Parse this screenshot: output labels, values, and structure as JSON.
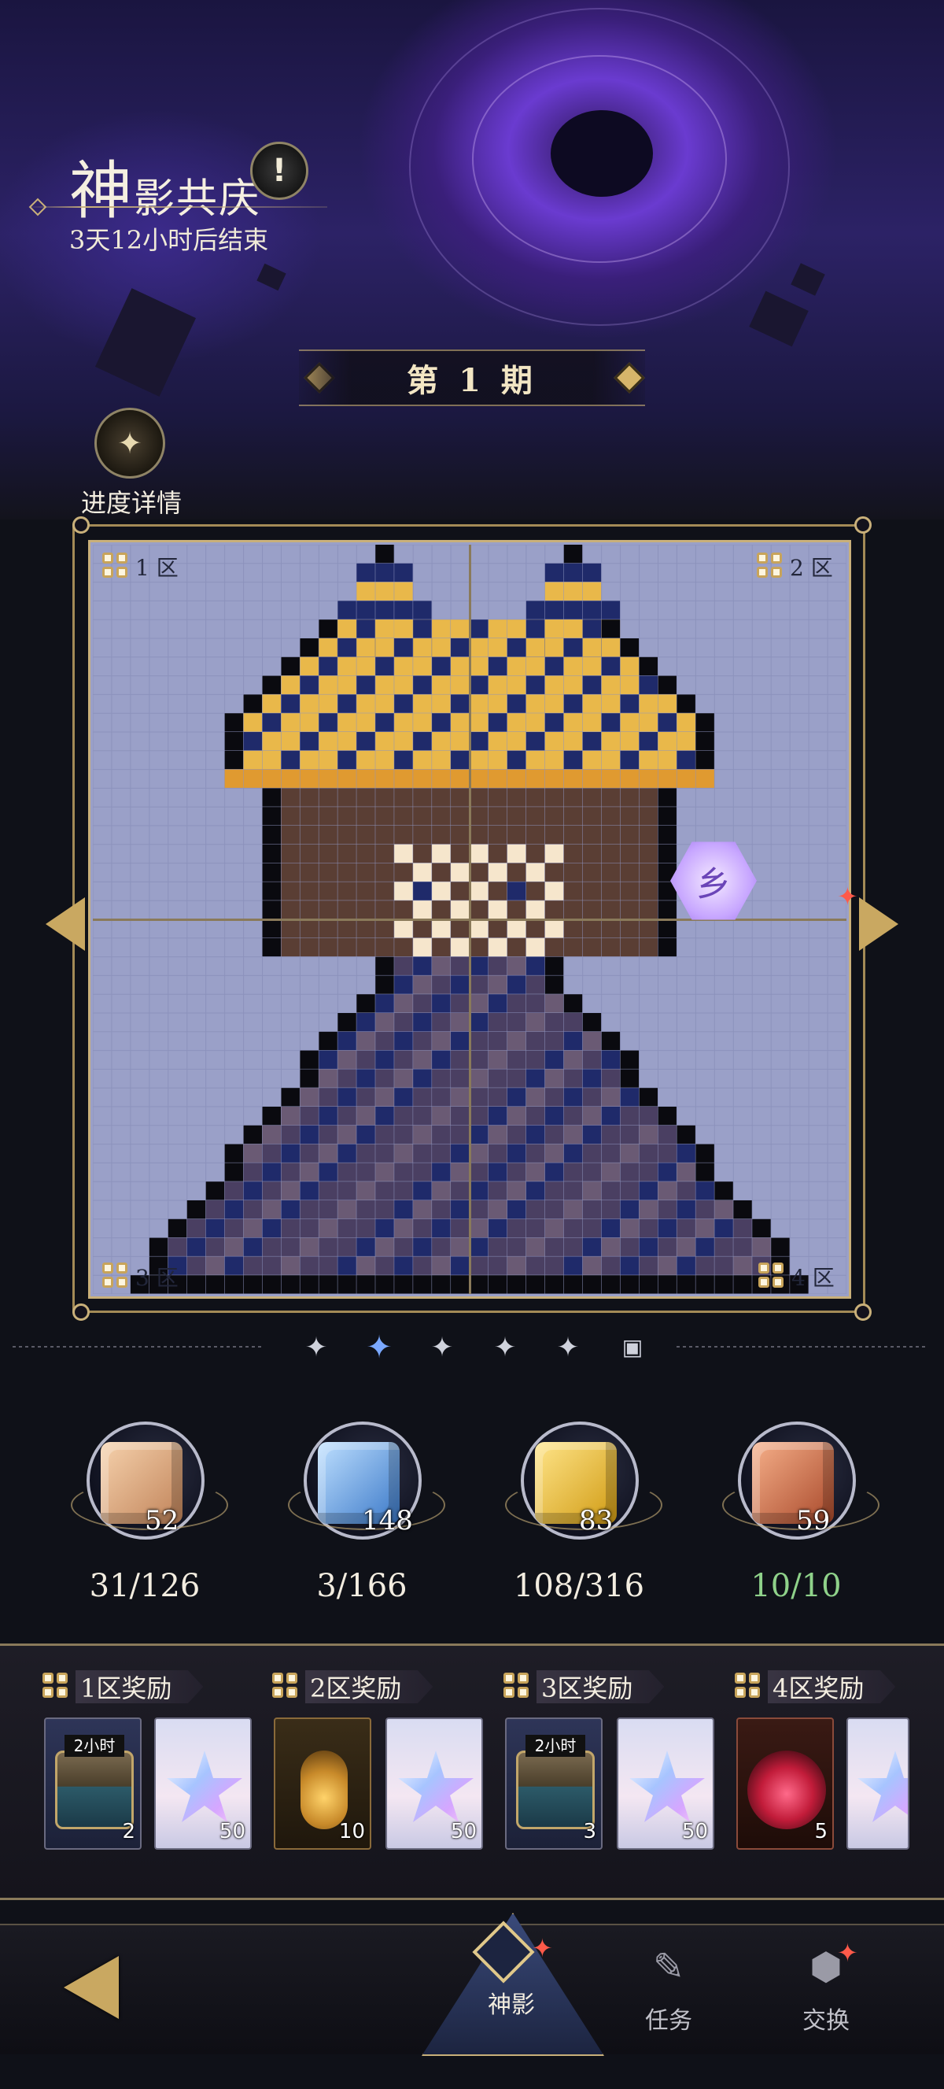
{
  "header": {
    "title_first_char": "神",
    "title_rest": "影共庆",
    "timer": "3天12小时后结束",
    "info_icon": "!",
    "period": "第 1 期",
    "progress_detail_label": "进度详情"
  },
  "board": {
    "zones": [
      {
        "label": "1 区"
      },
      {
        "label": "2 区"
      },
      {
        "label": "3 区"
      },
      {
        "label": "4 区"
      }
    ],
    "hex_badge_glyph": "乡",
    "colors": {
      "background": "#9aa0c8",
      "gold": "#e9b84a",
      "dark_blue": "#1f2a6a",
      "brown": "#5a3e34",
      "skin": "#f6e6cc",
      "black": "#0a0a0f"
    }
  },
  "stages": [
    "star-1",
    "star-2-active",
    "star-3",
    "star-4",
    "star-5",
    "chest"
  ],
  "cubes": [
    {
      "name": "peach-cube",
      "color": "#e6b58a",
      "count": "52",
      "progress": "31/126",
      "complete": false
    },
    {
      "name": "blue-cube",
      "color": "#6aa6e8",
      "count": "148",
      "progress": "3/166",
      "complete": false
    },
    {
      "name": "gold-cube",
      "color": "#f0c63a",
      "count": "83",
      "progress": "108/316",
      "complete": false
    },
    {
      "name": "copper-cube",
      "color": "#d27a52",
      "count": "59",
      "progress": "10/10",
      "complete": true
    }
  ],
  "rewards": [
    {
      "label": "1区奖励",
      "items": [
        {
          "type": "chest",
          "badge": "2小时",
          "qty": "2"
        },
        {
          "type": "star",
          "qty": "50"
        }
      ]
    },
    {
      "label": "2区奖励",
      "items": [
        {
          "type": "wand",
          "qty": "10"
        },
        {
          "type": "star",
          "qty": "50"
        }
      ]
    },
    {
      "label": "3区奖励",
      "items": [
        {
          "type": "chest",
          "badge": "2小时",
          "qty": "3"
        },
        {
          "type": "star",
          "qty": "50"
        }
      ]
    },
    {
      "label": "4区奖励",
      "items": [
        {
          "type": "staff",
          "qty": "5"
        },
        {
          "type": "star",
          "qty": ""
        }
      ]
    }
  ],
  "nav": {
    "back_icon": "back-arrow-icon",
    "tabs": [
      {
        "label": "神影",
        "icon": "diamond-icon",
        "active": true
      },
      {
        "label": "任务",
        "icon": "task-icon",
        "active": false
      },
      {
        "label": "交换",
        "icon": "exchange-icon",
        "active": false
      }
    ]
  }
}
